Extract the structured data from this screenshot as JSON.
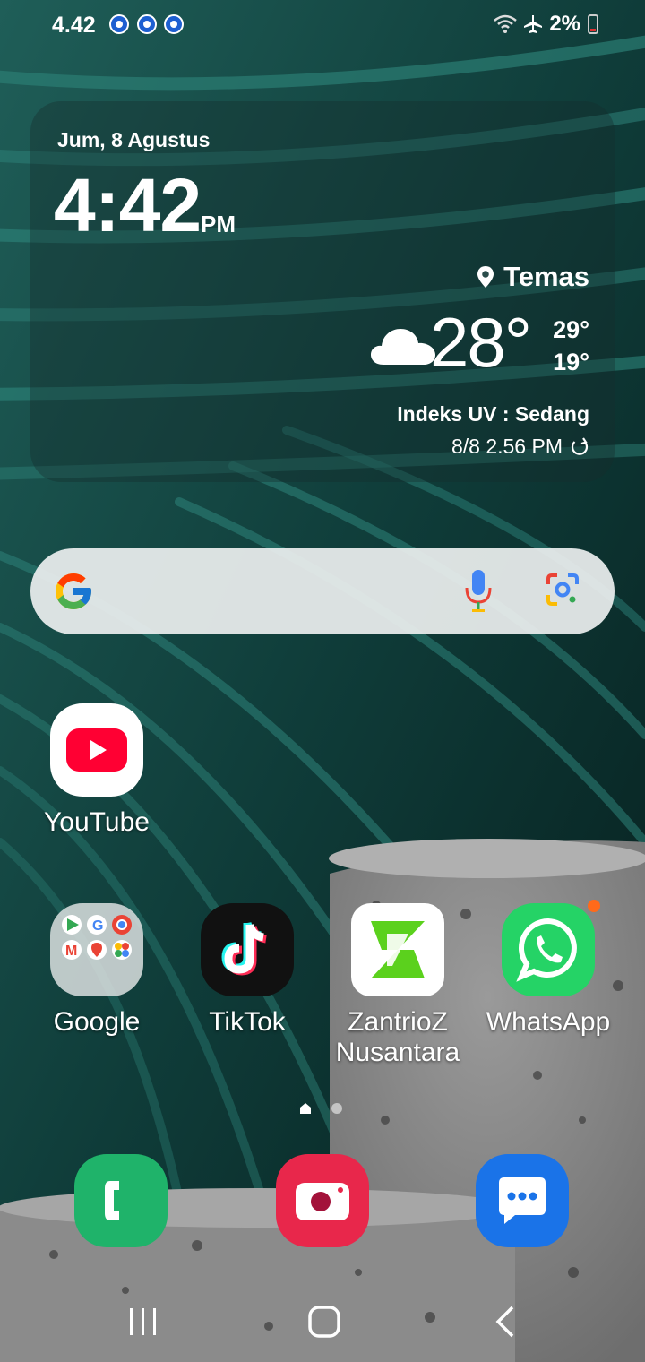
{
  "status_bar": {
    "time": "4.42",
    "battery_percent": "2%",
    "icons": [
      "notification-icon",
      "notification-icon",
      "notification-icon",
      "wifi-icon",
      "airplane-mode-icon",
      "battery-icon"
    ]
  },
  "widget": {
    "date": "Jum, 8 Agustus",
    "clock": "4:42",
    "ampm": "PM",
    "location": "Temas",
    "temperature": "28°",
    "high": "29°",
    "low": "19°",
    "condition_icon": "cloud-icon",
    "uv_index": "Indeks UV : Sedang",
    "updated": "8/8 2.56 PM"
  },
  "search_bar": {
    "icons": [
      "google-g-icon",
      "microphone-icon",
      "google-lens-icon"
    ]
  },
  "apps": {
    "youtube": "YouTube",
    "google": "Google",
    "tiktok": "TikTok",
    "zantrioz": "ZantrioZ\nNusantara",
    "whatsapp": "WhatsApp"
  },
  "dock": [
    "phone-icon",
    "camera-icon",
    "messages-icon"
  ],
  "page_indicator": {
    "pages": 2,
    "current": 1
  },
  "navigation": [
    "recents-button",
    "home-button",
    "back-button"
  ],
  "colors": {
    "youtube_red": "#ff0033",
    "whatsapp_green": "#25d366",
    "phone_green": "#1fb36a",
    "camera_red": "#e8274b",
    "messages_blue": "#1a73e8",
    "zantrioz_green": "#5bd11d"
  }
}
